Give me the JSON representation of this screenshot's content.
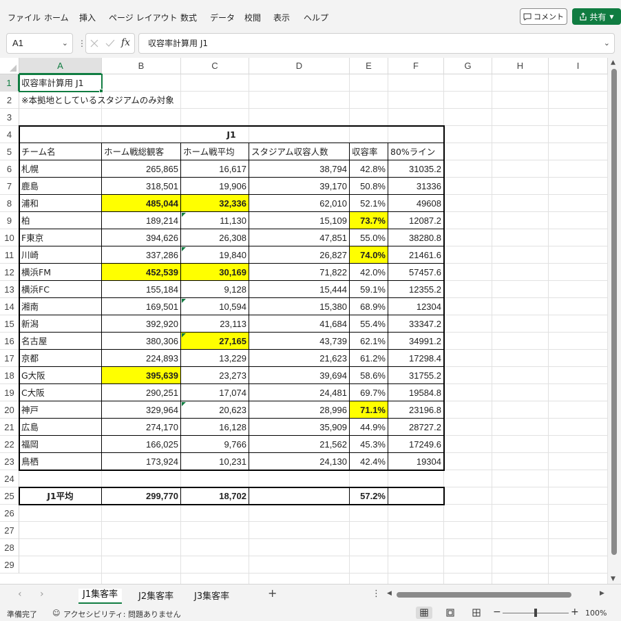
{
  "menu": {
    "items": [
      "ファイル",
      "ホーム",
      "挿入",
      "ページ レイアウト",
      "数式",
      "データ",
      "校閲",
      "表示",
      "ヘルプ"
    ],
    "comment_label": "コメント",
    "share_label": "共有"
  },
  "formula_bar": {
    "name_box": "A1",
    "fx_label": "fx",
    "formula": "収容率計算用 J1"
  },
  "columns": [
    "A",
    "B",
    "C",
    "D",
    "E",
    "F",
    "G",
    "H",
    "I"
  ],
  "rows": [
    "1",
    "2",
    "3",
    "4",
    "5",
    "6",
    "7",
    "8",
    "9",
    "10",
    "11",
    "12",
    "13",
    "14",
    "15",
    "16",
    "17",
    "18",
    "19",
    "20",
    "21",
    "22",
    "23",
    "24",
    "25",
    "26",
    "27",
    "28",
    "29"
  ],
  "sheet": {
    "a1": "収容率計算用 J1",
    "a2": "※本拠地としているスタジアムのみ対象",
    "table_title": "J1",
    "headers": [
      "チーム名",
      "ホーム戦総観客",
      "ホーム戦平均",
      "スタジアム収容人数",
      "収容率",
      "80%ライン"
    ],
    "data_rows": [
      {
        "team": "札幌",
        "total": "265,865",
        "avg": "16,617",
        "capacity": "38,794",
        "rate": "42.8%",
        "line80": "31035.2"
      },
      {
        "team": "鹿島",
        "total": "318,501",
        "avg": "19,906",
        "capacity": "39,170",
        "rate": "50.8%",
        "line80": "31336"
      },
      {
        "team": "浦和",
        "total": "485,044",
        "avg": "32,336",
        "capacity": "62,010",
        "rate": "52.1%",
        "line80": "49608"
      },
      {
        "team": "柏",
        "total": "189,214",
        "avg": "11,130",
        "capacity": "15,109",
        "rate": "73.7%",
        "line80": "12087.2"
      },
      {
        "team": "F東京",
        "total": "394,626",
        "avg": "26,308",
        "capacity": "47,851",
        "rate": "55.0%",
        "line80": "38280.8"
      },
      {
        "team": "川崎",
        "total": "337,286",
        "avg": "19,840",
        "capacity": "26,827",
        "rate": "74.0%",
        "line80": "21461.6"
      },
      {
        "team": "横浜FM",
        "total": "452,539",
        "avg": "30,169",
        "capacity": "71,822",
        "rate": "42.0%",
        "line80": "57457.6"
      },
      {
        "team": "横浜FC",
        "total": "155,184",
        "avg": "9,128",
        "capacity": "15,444",
        "rate": "59.1%",
        "line80": "12355.2"
      },
      {
        "team": "湘南",
        "total": "169,501",
        "avg": "10,594",
        "capacity": "15,380",
        "rate": "68.9%",
        "line80": "12304"
      },
      {
        "team": "新潟",
        "total": "392,920",
        "avg": "23,113",
        "capacity": "41,684",
        "rate": "55.4%",
        "line80": "33347.2"
      },
      {
        "team": "名古屋",
        "total": "380,306",
        "avg": "27,165",
        "capacity": "43,739",
        "rate": "62.1%",
        "line80": "34991.2"
      },
      {
        "team": "京都",
        "total": "224,893",
        "avg": "13,229",
        "capacity": "21,623",
        "rate": "61.2%",
        "line80": "17298.4"
      },
      {
        "team": "G大阪",
        "total": "395,639",
        "avg": "23,273",
        "capacity": "39,694",
        "rate": "58.6%",
        "line80": "31755.2"
      },
      {
        "team": "C大阪",
        "total": "290,251",
        "avg": "17,074",
        "capacity": "24,481",
        "rate": "69.7%",
        "line80": "19584.8"
      },
      {
        "team": "神戸",
        "total": "329,964",
        "avg": "20,623",
        "capacity": "28,996",
        "rate": "71.1%",
        "line80": "23196.8"
      },
      {
        "team": "広島",
        "total": "274,170",
        "avg": "16,128",
        "capacity": "35,909",
        "rate": "44.9%",
        "line80": "28727.2"
      },
      {
        "team": "福岡",
        "total": "166,025",
        "avg": "9,766",
        "capacity": "21,562",
        "rate": "45.3%",
        "line80": "17249.6"
      },
      {
        "team": "鳥栖",
        "total": "173,924",
        "avg": "10,231",
        "capacity": "24,130",
        "rate": "42.4%",
        "line80": "19304"
      }
    ],
    "highlights": {
      "total": [
        2,
        6,
        12
      ],
      "avg": [
        2,
        6,
        10
      ],
      "rate": [
        3,
        5,
        14
      ]
    },
    "avg_row": {
      "label": "J1平均",
      "total": "299,770",
      "avg": "18,702",
      "rate": "57.2%"
    }
  },
  "tabs": [
    "J1集客率",
    "J2集客率",
    "J3集客率"
  ],
  "status": {
    "ready": "準備完了",
    "accessibility": "アクセシビリティ: 問題ありません",
    "zoom": "100%"
  },
  "colors": {
    "accent": "#107c41",
    "highlight": "#ffff00"
  }
}
